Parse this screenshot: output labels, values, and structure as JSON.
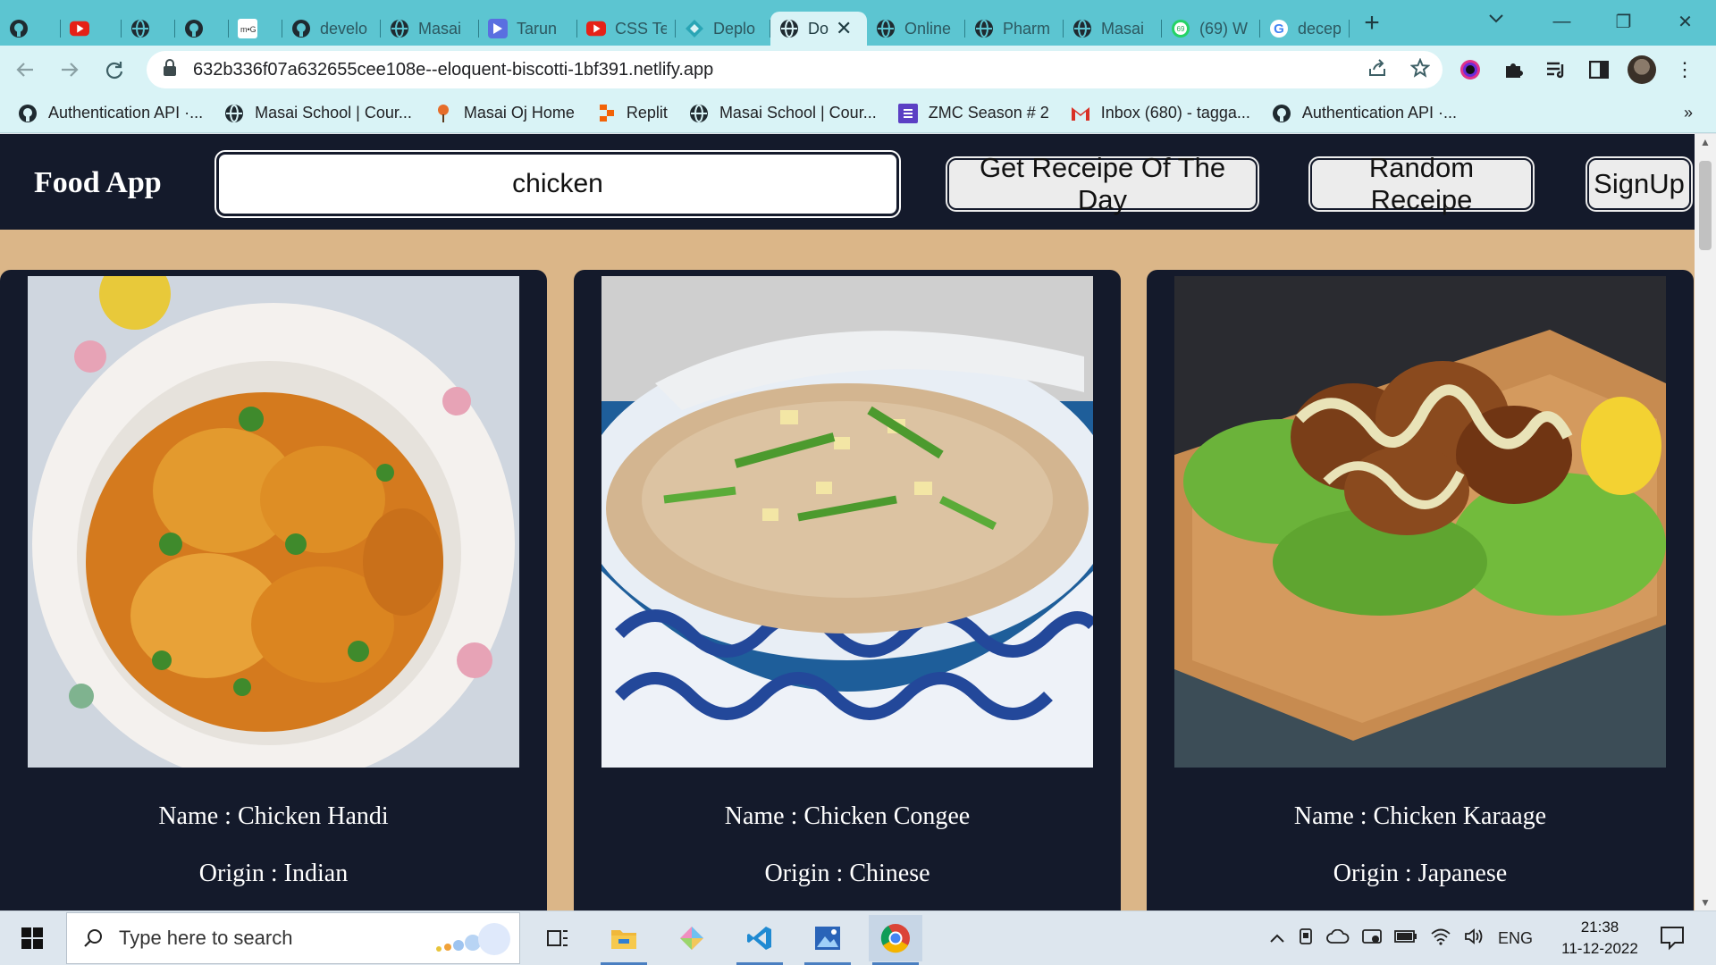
{
  "browser": {
    "tabs": [
      {
        "title": "",
        "icon": "github-icon"
      },
      {
        "title": "",
        "icon": "youtube-icon"
      },
      {
        "title": "",
        "icon": "globe-icon"
      },
      {
        "title": "",
        "icon": "github-icon"
      },
      {
        "title": "",
        "icon": "mg-icon"
      },
      {
        "title": "develo",
        "icon": "github-icon"
      },
      {
        "title": "Masai",
        "icon": "globe-icon"
      },
      {
        "title": "Tarun",
        "icon": "bookmark-flag-icon"
      },
      {
        "title": "CSS Te",
        "icon": "youtube-icon"
      },
      {
        "title": "Deplo",
        "icon": "netlify-icon"
      },
      {
        "title": "Do",
        "icon": "globe-icon",
        "active": true
      },
      {
        "title": "Online",
        "icon": "globe-icon"
      },
      {
        "title": "Pharm",
        "icon": "globe-icon"
      },
      {
        "title": "Masai",
        "icon": "globe-icon"
      },
      {
        "title": "(69) W",
        "icon": "whatsapp-icon"
      },
      {
        "title": "decep",
        "icon": "google-icon"
      }
    ],
    "url": "632b336f07a632655cee108e--eloquent-biscotti-1bf391.netlify.app",
    "bookmarks": [
      {
        "label": "Authentication API ·...",
        "icon": "github-icon"
      },
      {
        "label": "Masai School | Cour...",
        "icon": "globe-icon"
      },
      {
        "label": "Masai Oj Home",
        "icon": "pin-icon"
      },
      {
        "label": "Replit",
        "icon": "replit-icon"
      },
      {
        "label": "Masai School | Cour...",
        "icon": "globe-icon"
      },
      {
        "label": "ZMC Season # 2",
        "icon": "list-icon"
      },
      {
        "label": "Inbox (680) - tagga...",
        "icon": "gmail-icon"
      },
      {
        "label": "Authentication API ·...",
        "icon": "github-icon"
      }
    ],
    "more_bookmarks": "»"
  },
  "app": {
    "brand": "Food App",
    "search_value": "chicken",
    "buttons": {
      "recipe_of_day": "Get Receipe Of The Day",
      "random": "Random Receipe",
      "signup": "SignUp"
    },
    "cards": [
      {
        "name_line": "Name : Chicken Handi",
        "origin_line": "Origin : Indian"
      },
      {
        "name_line": "Name : Chicken Congee",
        "origin_line": "Origin : Chinese"
      },
      {
        "name_line": "Name : Chicken Karaage",
        "origin_line": "Origin : Japanese"
      }
    ]
  },
  "taskbar": {
    "search_placeholder": "Type here to search",
    "language": "ENG",
    "time": "21:38",
    "date": "11-12-2022",
    "whatsapp_badge": "69"
  },
  "colors": {
    "tab_strip": "#5cc5d1",
    "toolbar": "#d9f3f6",
    "app_nav": "#141a2b",
    "page_bg": "#dbb688",
    "card_bg": "#141a2b"
  }
}
